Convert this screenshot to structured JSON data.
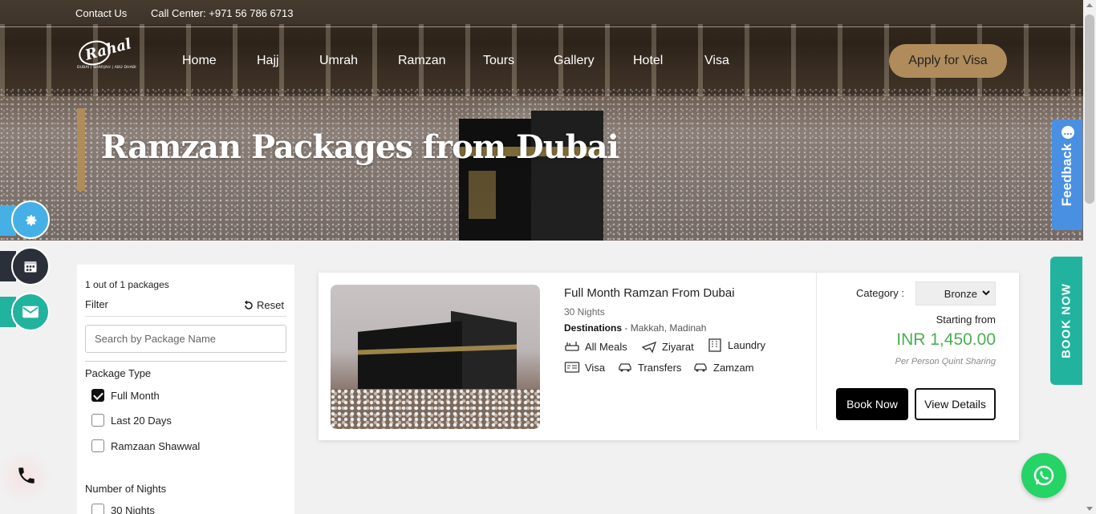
{
  "topbar": {
    "contact": "Contact Us",
    "call_center": "Call Center: +971 56 786 6713"
  },
  "logo": {
    "mark": "Rahal",
    "tagline": "DUBAI | SHARJAH | ABU DHABI"
  },
  "nav": {
    "items": [
      "Home",
      "Hajj",
      "Umrah",
      "Ramzan",
      "Tours",
      "Gallery",
      "Hotel",
      "Visa"
    ],
    "cta": "Apply for Visa"
  },
  "hero": {
    "title": "Ramzan Packages from Dubai"
  },
  "side_tabs": {
    "feedback": "Feedback",
    "book_now": "BOOK NOW"
  },
  "float_icons": [
    "gear-icon",
    "calendar-icon",
    "envelope-icon",
    "phone-icon",
    "whatsapp-icon"
  ],
  "filter": {
    "count": "1 out of 1 packages",
    "label": "Filter",
    "reset": "Reset",
    "search_placeholder": "Search by Package Name",
    "package_type": {
      "heading": "Package Type",
      "options": [
        {
          "label": "Full Month",
          "checked": true
        },
        {
          "label": "Last 20 Days",
          "checked": false
        },
        {
          "label": "Ramzaan Shawwal",
          "checked": false
        }
      ]
    },
    "nights": {
      "heading": "Number of Nights",
      "options": [
        {
          "label": "30 Nights",
          "checked": false
        }
      ]
    }
  },
  "package": {
    "name": "Full Month Ramzan From Dubai",
    "nights": "30 Nights",
    "destinations_label": "Destinations",
    "destinations": "Makkah, Madinah",
    "amenities": [
      "All Meals",
      "Ziyarat",
      "Laundry",
      "Visa",
      "Transfers",
      "Zamzam"
    ],
    "category_label": "Category :",
    "category_value": "Bronze",
    "starting_from": "Starting from",
    "price": "INR 1,450.00",
    "price_note": "Per Person Quint Sharing",
    "book_now": "Book Now",
    "view_details": "View Details"
  },
  "colors": {
    "accent": "#b08c5c",
    "price_green": "#4caf50",
    "feedback_blue": "#4a90e2",
    "booknow_teal": "#22b39f",
    "whatsapp_green": "#25d366"
  }
}
